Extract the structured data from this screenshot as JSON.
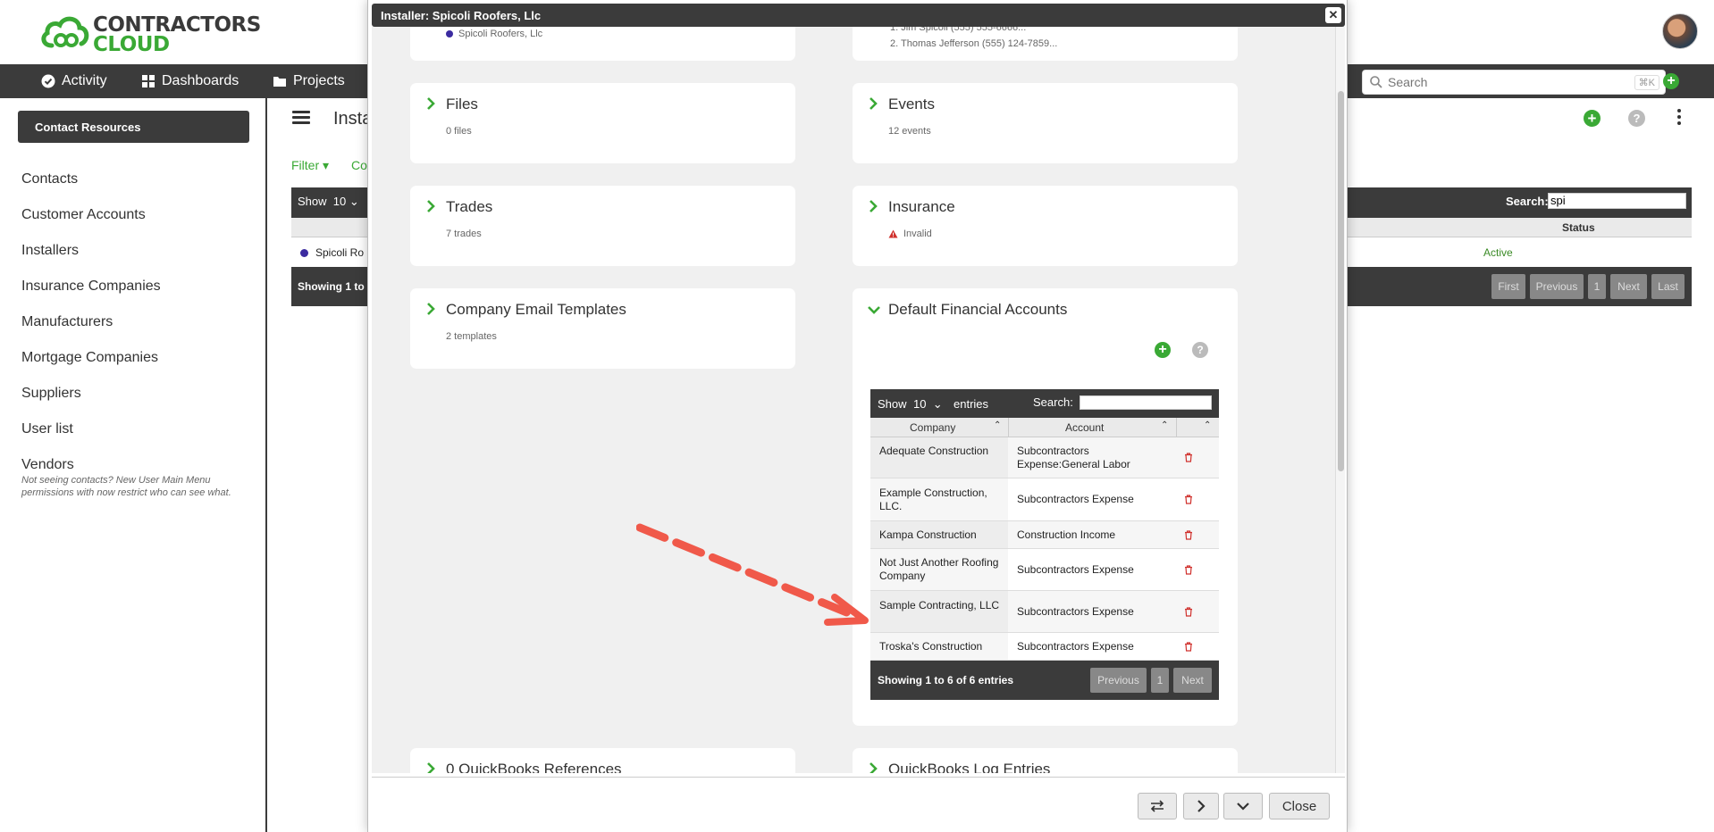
{
  "brand": {
    "line1": "CONTRACTORS",
    "line2": "CLOUD",
    "green": "#3aa935",
    "dark": "#3b3b3b"
  },
  "nav": {
    "items": [
      {
        "label": "Activity",
        "icon": "check-circle-icon"
      },
      {
        "label": "Dashboards",
        "icon": "grid-icon"
      },
      {
        "label": "Projects",
        "icon": "folder-icon"
      }
    ],
    "search_placeholder": "Search",
    "search_shortcut": "⌘K"
  },
  "sidebar": {
    "header": "Contact Resources",
    "items": [
      "Contacts",
      "Customer Accounts",
      "Installers",
      "Insurance Companies",
      "Manufacturers",
      "Mortgage Companies",
      "Suppliers",
      "User list",
      "Vendors"
    ],
    "note": "Not seeing contacts? New User Main Menu permissions with now restrict who can see what."
  },
  "main": {
    "title": "Insta",
    "filter": "Filter",
    "columns": "Co",
    "show": "Show",
    "show_value": "10",
    "search_label": "Search:",
    "search_value": "spi",
    "status_header": "Status",
    "row_name": "Spicoli Ro",
    "row_status": "Active",
    "showing": "Showing 1 to",
    "pagination": [
      "First",
      "Previous",
      "1",
      "Next",
      "Last"
    ]
  },
  "modal": {
    "title": "Installer: Spicoli Roofers, Llc",
    "top_left_item": "Spicoli Roofers, Llc",
    "top_right_items": [
      "1. Jim Spicoli (555) 555-6666...",
      "2. Thomas Jefferson (555) 124-7859..."
    ],
    "cards": {
      "files": {
        "title": "Files",
        "sub": "0 files"
      },
      "events": {
        "title": "Events",
        "sub": "12 events"
      },
      "trades": {
        "title": "Trades",
        "sub": "7 trades"
      },
      "insurance": {
        "title": "Insurance",
        "sub": "Invalid"
      },
      "email": {
        "title": "Company Email Templates",
        "sub": "2 templates"
      },
      "accounts": {
        "title": "Default Financial Accounts"
      },
      "qb_refs": {
        "title": "0 QuickBooks References"
      },
      "qb_log": {
        "title": "QuickBooks Log Entries"
      }
    },
    "fa_table": {
      "show": "Show",
      "show_value": "10",
      "entries": "entries",
      "search_label": "Search:",
      "headers": [
        "Company",
        "Account"
      ],
      "rows": [
        {
          "company": "Adequate Construction",
          "account": "Subcontractors Expense:General Labor"
        },
        {
          "company": "Example Construction, LLC.",
          "account": "Subcontractors Expense"
        },
        {
          "company": "Kampa Construction",
          "account": "Construction Income"
        },
        {
          "company": "Not Just Another Roofing Company",
          "account": "Subcontractors Expense"
        },
        {
          "company": "Sample Contracting, LLC",
          "account": "Subcontractors Expense"
        },
        {
          "company": "Troska's Construction",
          "account": "Subcontractors Expense"
        }
      ],
      "showing": "Showing 1 to 6 of 6 entries",
      "pagination": [
        "Previous",
        "1",
        "Next"
      ]
    },
    "footer": {
      "close": "Close"
    }
  }
}
